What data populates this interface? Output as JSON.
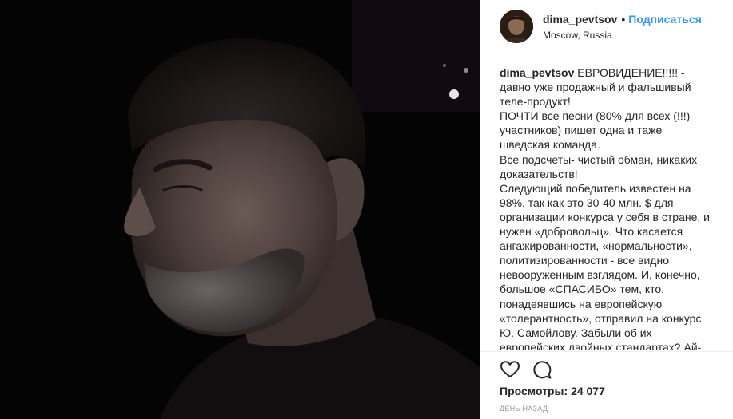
{
  "post": {
    "username": "dima_pevtsov",
    "separator": "•",
    "follow_label": "Подписаться",
    "location": "Moscow, Russia",
    "caption_username": "dima_pevtsov",
    "caption_text": "ЕВРОВИДЕНИЕ!!!!! - давно уже продажный и фальшивый теле-продукт!\nПОЧТИ все песни (80% для всех (!!!) участников) пишет одна и таже шведская команда.\nВсе подсчеты- чистый обман, никаких доказательств!\nСледующий победитель известен на 98%, так как это 30-40 млн. $ для организации конкурса у себя в стране, и нужен «добровольц». Что касается ангажированности, «нормальности», политизированности - все видно невооруженным взглядом. И, конечно, большое «СПАСИБО» тем, кто, понадеявшись на европейскую «толерантность», отправил на конкурс Ю. Самойлову. Забыли об их европейских двойных стандартах? Ай-ай",
    "views_label": "Просмотры:",
    "views_count": "24 077",
    "timestamp": "ДЕНЬ НАЗАД"
  },
  "icons": {
    "like": "heart-icon",
    "comment": "comment-icon"
  },
  "colors": {
    "follow": "#3897f0",
    "text": "#262626",
    "muted": "#999999",
    "media_bg": "#050405"
  }
}
